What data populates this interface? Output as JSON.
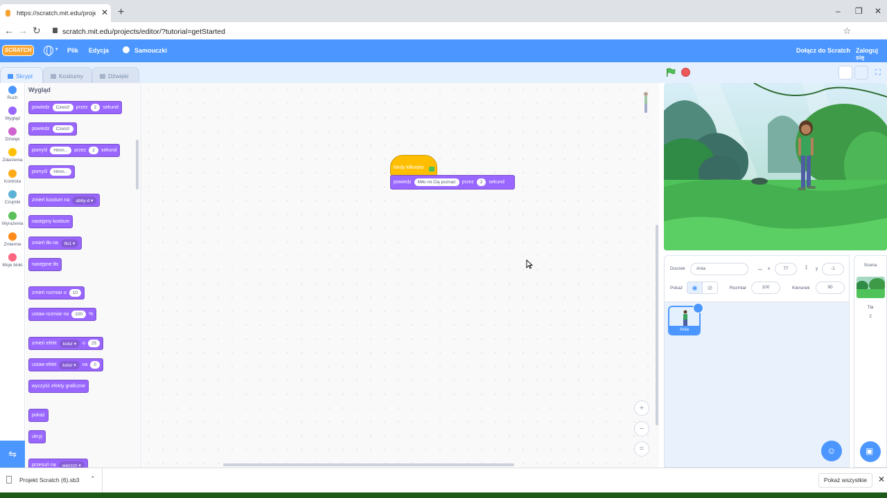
{
  "browser": {
    "tab_title": "https://scratch.mit.edu/projects/e",
    "tab_close": "✕",
    "new_tab": "+",
    "url": "scratch.mit.edu/projects/editor/?tutorial=getStarted",
    "window_controls": [
      "–",
      "❐",
      "✕"
    ]
  },
  "menubar": {
    "logo": "SCRATCH",
    "file": "Plik",
    "edit": "Edycja",
    "tutorials": "Samouczki",
    "join": "Dołącz do Scratch",
    "signin": "Zaloguj się"
  },
  "tabs": {
    "code": "Skrypt",
    "costumes": "Kostiumy",
    "sounds": "Dźwięki"
  },
  "categories": [
    {
      "label": "Ruch",
      "color": "#4c97ff"
    },
    {
      "label": "Wygląd",
      "color": "#9966ff"
    },
    {
      "label": "Dźwięk",
      "color": "#cf63cf"
    },
    {
      "label": "Zdarzenia",
      "color": "#ffbf00"
    },
    {
      "label": "Kontrola",
      "color": "#ffab19"
    },
    {
      "label": "Czujniki",
      "color": "#5cb1d6"
    },
    {
      "label": "Wyrażenia",
      "color": "#59c059"
    },
    {
      "label": "Zmienne",
      "color": "#ff8c1a"
    },
    {
      "label": "Moje bloki",
      "color": "#ff6680"
    }
  ],
  "palette": {
    "title": "Wygląd",
    "blocks": {
      "say_for": {
        "a": "powiedz",
        "in1": "Cześć!",
        "b": "przez",
        "in2": "2",
        "c": "sekund"
      },
      "say": {
        "a": "powiedz",
        "in1": "Cześć!"
      },
      "think_for": {
        "a": "pomyśl",
        "in1": "Hmm...",
        "b": "przez",
        "in2": "2",
        "c": "sekund"
      },
      "think": {
        "a": "pomyśl",
        "in1": "Hmm..."
      },
      "switch_costume": {
        "a": "zmień kostium na",
        "dd": "abby-d ▾"
      },
      "next_costume": "następny kostium",
      "switch_backdrop": {
        "a": "zmień tło na",
        "dd": "tło1 ▾"
      },
      "next_backdrop": "następne tło",
      "change_size": {
        "a": "zmień rozmiar o",
        "in1": "10"
      },
      "set_size": {
        "a": "ustaw rozmiar na",
        "in1": "100",
        "b": "%"
      },
      "change_effect": {
        "a": "zmień efekt",
        "dd": "kolor ▾",
        "b": "o",
        "in1": "25"
      },
      "set_effect": {
        "a": "ustaw efekt",
        "dd": "kolor ▾",
        "b": "na",
        "in1": "0"
      },
      "clear_effects": "wyczyść efekty graficzne",
      "show": "pokaż",
      "hide": "ukryj",
      "goto_layer": {
        "a": "przesuń na",
        "dd": "wierzch ▾"
      }
    }
  },
  "script": {
    "hat_label": "kiedy kliknięto",
    "say": {
      "a": "powiedz",
      "in1": "Miło mi Cię poznać",
      "b": "przez",
      "in2": "2",
      "c": "sekund"
    },
    "zoom_in": "+",
    "zoom_out": "−",
    "zoom_reset": "="
  },
  "sprite_info": {
    "sprite_label": "Duszek",
    "sprite_name": "Ania",
    "x_label": "x",
    "x_value": "77",
    "y_label": "y",
    "y_value": "-1",
    "show_label": "Pokaż",
    "size_label": "Rozmiar",
    "size_value": "100",
    "direction_label": "Kierunek",
    "direction_value": "90"
  },
  "sprite_list": {
    "sprites": [
      {
        "name": "Ania"
      }
    ]
  },
  "stage_pane": {
    "title": "Scena",
    "backdrops_label": "Tła",
    "backdrops_count": "2"
  },
  "download_bar": {
    "file_name": "Projekt Scratch (6).sb3",
    "show_all": "Pokaż wszystkie",
    "close": "✕"
  },
  "colors": {
    "scratch_blue": "#4c97ff",
    "looks_purple": "#9966ff",
    "events_yellow": "#ffbf00"
  }
}
